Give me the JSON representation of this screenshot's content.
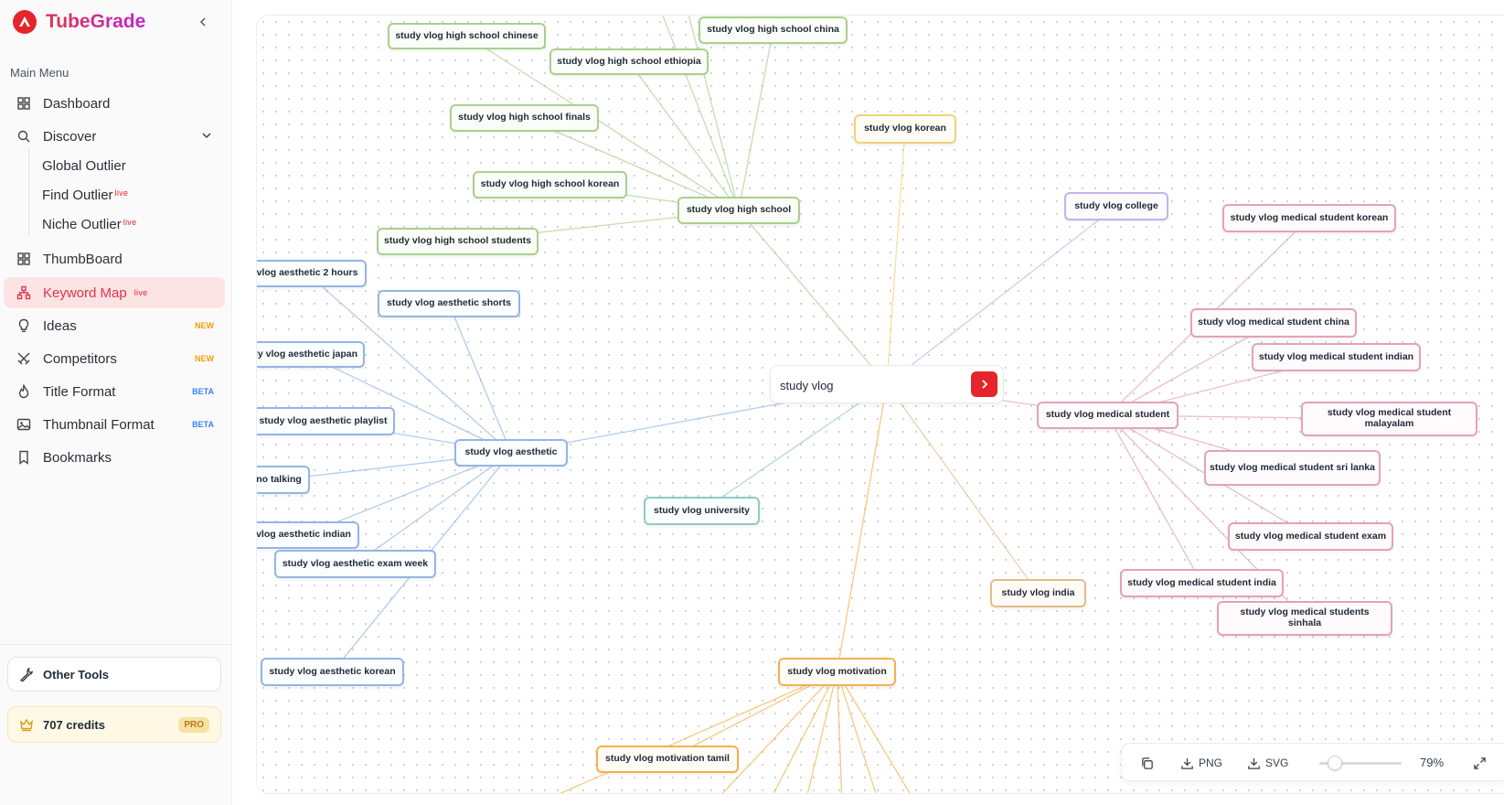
{
  "app": {
    "name": "TubeGrade"
  },
  "sidebar": {
    "menu_heading": "Main Menu",
    "items": [
      {
        "label": "Dashboard",
        "icon": "grid-icon"
      },
      {
        "label": "Discover",
        "icon": "search-icon"
      },
      {
        "label": "ThumbBoard",
        "icon": "grid-icon"
      },
      {
        "label": "Keyword Map",
        "icon": "network-icon",
        "tag": "live"
      },
      {
        "label": "Ideas",
        "icon": "lightbulb-icon",
        "tag": "NEW"
      },
      {
        "label": "Competitors",
        "icon": "swords-icon",
        "tag": "NEW"
      },
      {
        "label": "Title Format",
        "icon": "flame-icon",
        "tag": "BETA"
      },
      {
        "label": "Thumbnail Format",
        "icon": "image-icon",
        "tag": "BETA"
      },
      {
        "label": "Bookmarks",
        "icon": "bookmark-icon"
      }
    ],
    "discover_sub": [
      {
        "label": "Global Outlier"
      },
      {
        "label": "Find Outlier",
        "tag": "live"
      },
      {
        "label": "Niche Outlier",
        "tag": "live"
      }
    ],
    "other_tools": "Other Tools",
    "credits": "707 credits",
    "plan": "PRO"
  },
  "map": {
    "root": "study vlog",
    "nodes": [
      {
        "id": "hs",
        "label": "study vlog high school",
        "color": "green"
      },
      {
        "id": "hs1",
        "label": "study vlog high school chinese",
        "color": "green"
      },
      {
        "id": "hs2",
        "label": "study vlog high school china",
        "color": "green"
      },
      {
        "id": "hs3",
        "label": "study vlog high school ethiopia",
        "color": "green"
      },
      {
        "id": "hs4",
        "label": "study vlog high school finals",
        "color": "green"
      },
      {
        "id": "hs5",
        "label": "study vlog high school korean",
        "color": "green"
      },
      {
        "id": "hs6",
        "label": "study vlog high school students",
        "color": "green"
      },
      {
        "id": "ko",
        "label": "study vlog korean",
        "color": "yellow"
      },
      {
        "id": "co",
        "label": "study vlog college",
        "color": "purple"
      },
      {
        "id": "ae",
        "label": "study vlog aesthetic",
        "color": "blue"
      },
      {
        "id": "ae1",
        "label": "vlog aesthetic 2 hours",
        "color": "blue"
      },
      {
        "id": "ae2",
        "label": "study vlog aesthetic shorts",
        "color": "blue"
      },
      {
        "id": "ae3",
        "label": "ly vlog aesthetic japan",
        "color": "blue"
      },
      {
        "id": "ae4",
        "label": "study vlog aesthetic playlist",
        "color": "blue"
      },
      {
        "id": "ae5",
        "label": "no talking",
        "color": "blue"
      },
      {
        "id": "ae6",
        "label": "vlog aesthetic indian",
        "color": "blue"
      },
      {
        "id": "ae7",
        "label": "study vlog aesthetic exam week",
        "color": "blue"
      },
      {
        "id": "ae8",
        "label": "study vlog aesthetic korean",
        "color": "blue"
      },
      {
        "id": "un",
        "label": "study vlog university",
        "color": "teal"
      },
      {
        "id": "in",
        "label": "study vlog india",
        "color": "tan"
      },
      {
        "id": "mo",
        "label": "study vlog motivation",
        "color": "orange"
      },
      {
        "id": "mo1",
        "label": "study vlog motivation tamil",
        "color": "orange"
      },
      {
        "id": "ms",
        "label": "study vlog medical student",
        "color": "pink"
      },
      {
        "id": "ms1",
        "label": "study vlog medical student korean",
        "color": "pink"
      },
      {
        "id": "ms2",
        "label": "study vlog medical student china",
        "color": "pink"
      },
      {
        "id": "ms3",
        "label": "study vlog medical student indian",
        "color": "pink"
      },
      {
        "id": "ms4",
        "label": "study vlog medical student malayalam",
        "color": "pink"
      },
      {
        "id": "ms5",
        "label": "study vlog medical student sri lanka",
        "color": "pink"
      },
      {
        "id": "ms6",
        "label": "study vlog medical student exam",
        "color": "pink"
      },
      {
        "id": "ms7",
        "label": "study vlog medical student india",
        "color": "pink"
      },
      {
        "id": "ms8",
        "label": "study vlog medical students sinhala",
        "color": "pink"
      }
    ]
  },
  "toolbar": {
    "png": "PNG",
    "svg": "SVG",
    "zoom": "79%",
    "zoom_level": 0.79
  },
  "colors": {
    "accent": "#e5242b",
    "green": "#a9d08e",
    "blue": "#93b5e4",
    "pink": "#e2a3b8",
    "yellow": "#f0d278",
    "orange": "#f5b04e",
    "purple": "#c3b2ea",
    "teal": "#8fcbc0",
    "tan": "#e2bd86"
  }
}
